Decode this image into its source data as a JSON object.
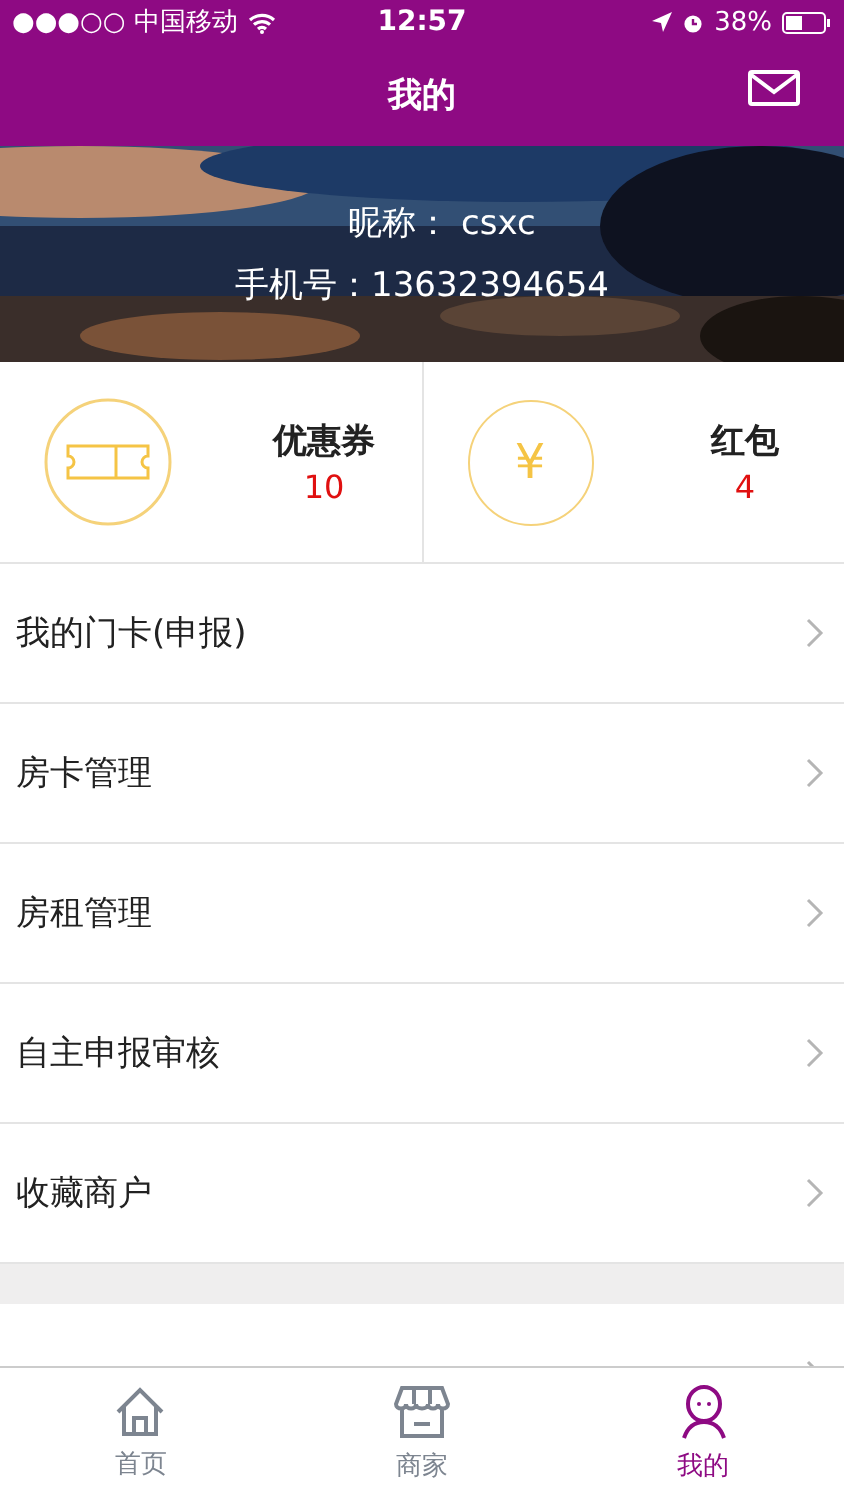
{
  "status_bar": {
    "carrier": "●●●○○ 中国移动",
    "time": "12:57",
    "battery": "38%"
  },
  "nav": {
    "title": "我的"
  },
  "profile": {
    "nickname": "昵称：  csxc",
    "phone": "手机号：13632394654"
  },
  "wallet": [
    {
      "kind": "coupon",
      "label": "优惠券",
      "count": "10"
    },
    {
      "kind": "money",
      "label": "红包",
      "count": "4",
      "symbol": "¥"
    }
  ],
  "menu": [
    {
      "label": "我的门卡(申报)"
    },
    {
      "label": "房卡管理"
    },
    {
      "label": "房租管理"
    },
    {
      "label": "自主申报审核"
    },
    {
      "label": "收藏商户"
    }
  ],
  "tabs": [
    {
      "kind": "home",
      "label": "首页",
      "selected": false
    },
    {
      "kind": "shop",
      "label": "商家",
      "selected": false
    },
    {
      "kind": "me",
      "label": "我的",
      "selected": true
    }
  ]
}
